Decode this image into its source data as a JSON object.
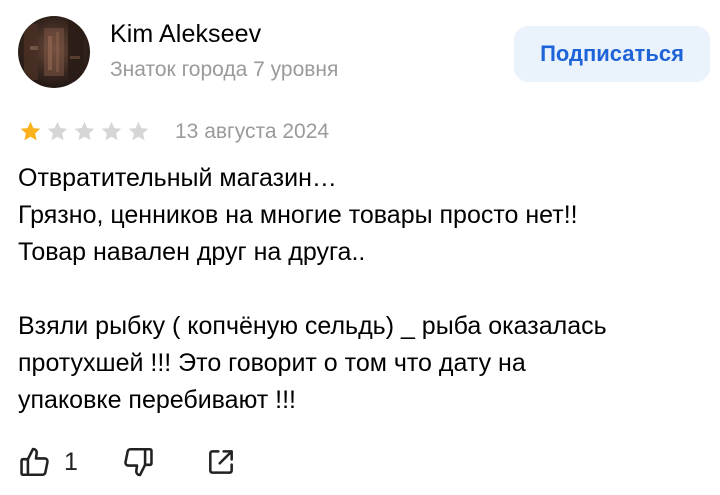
{
  "review": {
    "author": {
      "name": "Kim Alekseev",
      "level": "Знаток города 7 уровня"
    },
    "subscribe_label": "Подписаться",
    "rating": 1,
    "rating_max": 5,
    "date": "13 августа 2024",
    "text": {
      "line1": "Отвратительный магазин…",
      "line2": "Грязно, ценников на многие товары просто нет!!",
      "line3": "Товар навален друг на друга..",
      "line4": "Взяли рыбку ( копчёную сельдь) _ рыба оказалась",
      "line5": "протухшей !!! Это говорит о том что дату на",
      "line6": "упаковке перебивают !!!"
    },
    "likes": "1"
  },
  "colors": {
    "star_filled": "#fcb21d",
    "star_empty": "#d6d6d6",
    "accent": "#1e64d8",
    "subscribe_bg": "#eaf2fc",
    "muted_text": "#9a9a9a"
  },
  "icons": {
    "like": "thumbs-up-icon",
    "dislike": "thumbs-down-icon",
    "share": "share-icon",
    "star": "star-icon"
  }
}
